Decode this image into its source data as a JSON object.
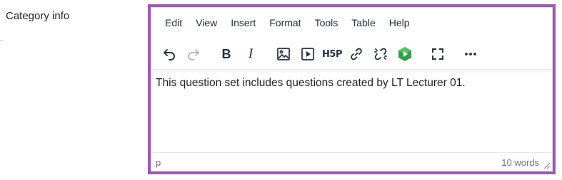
{
  "field": {
    "label": "Category info"
  },
  "editor": {
    "menubar": [
      "Edit",
      "View",
      "Insert",
      "Format",
      "Tools",
      "Table",
      "Help"
    ],
    "toolbar": {
      "icons": [
        "undo-icon",
        "redo-icon",
        "bold-icon",
        "italic-icon",
        "image-icon",
        "media-icon",
        "h5p-icon",
        "link-icon",
        "unlink-icon",
        "panopto-icon",
        "fullscreen-icon",
        "more-icon"
      ],
      "h5p_label": "H5P",
      "bold_label": "B",
      "italic_label": "I"
    },
    "content": "This question set includes questions created by LT Lecturer 01.",
    "status": {
      "path": "p",
      "word_count": "10 words"
    },
    "colors": {
      "focus_border": "#9a5aaf",
      "icon": "#222f3e",
      "disabled_icon": "#b5b9be",
      "panopto_green": "#2f9e44"
    }
  }
}
